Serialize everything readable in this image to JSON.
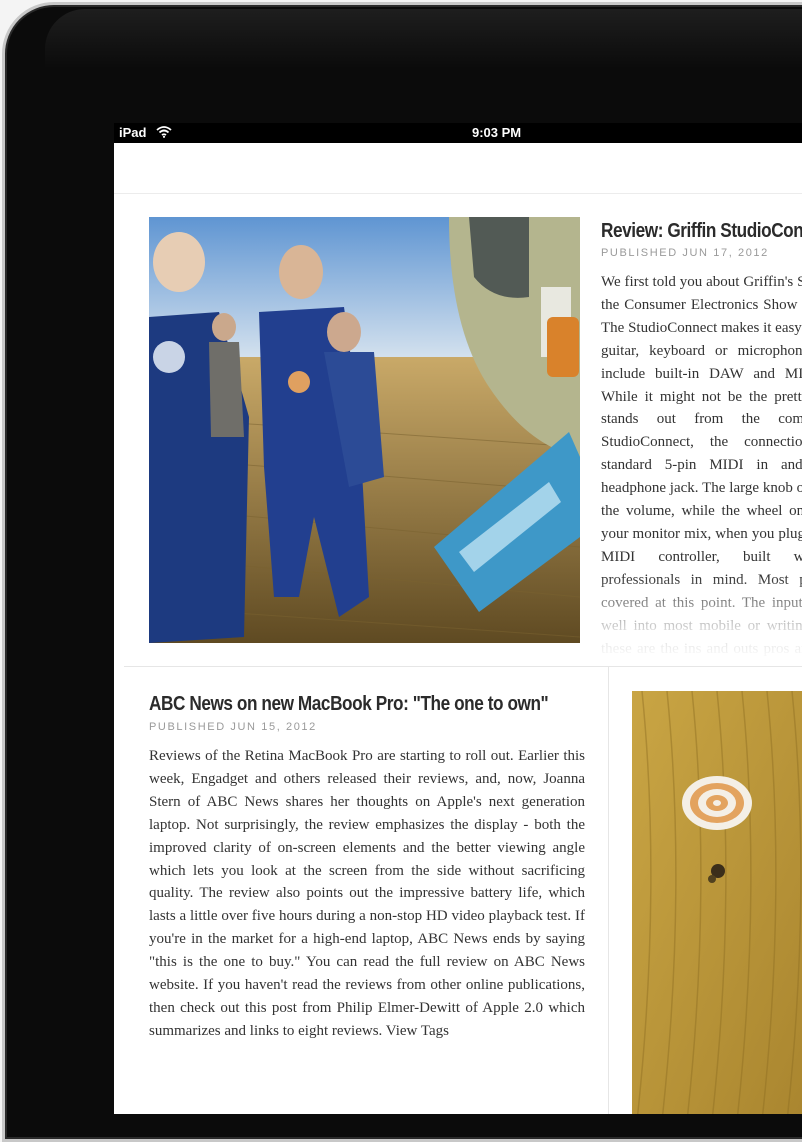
{
  "status_bar": {
    "carrier": "iPad",
    "time": "9:03 PM"
  },
  "articles": [
    {
      "title": "Review: Griffin StudioConnect",
      "published": "PUBLISHED JUN 17, 2012",
      "body": "We first told you about Griffin's StudioConnect at the Consumer Electronics Show earlier this year. The StudioConnect makes it easy to hook up your guitar, keyboard or microphone to apps that include built-in DAW and MIDI capabilities. While it might not be the prettiest interface, it stands out from the competition. With StudioConnect, the connections are basic: standard 5-pin MIDI in and out ports, a headphone jack. The large knob out front controls the volume, while the wheel on the side is for your monitor mix, when you plug in a guitar, or a MIDI controller, built with recording professionals in mind. Most players will be covered at this point. The inputs above will fit well into most mobile or writing setups. While these are the ins and outs pros are familiar with, Griffin also adds an extra wrinkle, where the competition gets it wrong. Most other audio interfaces with iPad support (so far) can't charge the iPad while recording/performing."
    },
    {
      "title": "ABC News on new MacBook Pro: \"The one to own\"",
      "published": "PUBLISHED JUN 15, 2012",
      "body": "Reviews of the Retina MacBook Pro are starting to roll out. Earlier this week, Engadget and others released their reviews, and, now, Joanna Stern of ABC News shares her thoughts on Apple's next generation laptop. Not surprisingly, the review emphasizes the display - both the improved clarity of on-screen elements and the better viewing angle which lets you look at the screen from the side without sacrificing quality. The review also points out the impressive battery life, which lasts a little over five hours during a non-stop HD video playback test. If you're in the market for a high-end laptop, ABC News ends by saying \"this is the one to buy.\" You can read the full review on ABC News website. If you haven't read the reviews from other online publications, then check out this post from Philip Elmer-Dewitt of Apple 2.0 which summarizes and links to eight reviews.",
      "view_tags": "View Tags"
    }
  ],
  "colors": {
    "title": "#2b2b2b",
    "meta": "#9a9a9a",
    "body": "#333333",
    "status_bar": "#000000"
  },
  "icons": [
    "wifi-icon"
  ]
}
